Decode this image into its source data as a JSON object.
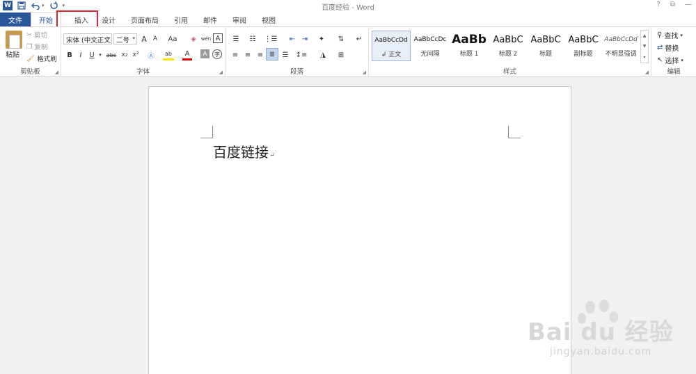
{
  "window": {
    "title": "百度经验 - Word",
    "help": "?",
    "restore": "⧉",
    "minimize": "—"
  },
  "quick_access": {
    "app_icon_letter": "W",
    "save_icon": "save-icon",
    "undo_icon": "undo-icon",
    "redo_icon": "redo-icon"
  },
  "tabs": [
    {
      "label": "文件"
    },
    {
      "label": "开始"
    },
    {
      "label": "插入"
    },
    {
      "label": "设计"
    },
    {
      "label": "页面布局"
    },
    {
      "label": "引用"
    },
    {
      "label": "邮件"
    },
    {
      "label": "审阅"
    },
    {
      "label": "视图"
    }
  ],
  "ribbon": {
    "clipboard": {
      "label": "剪贴板",
      "paste": "粘贴",
      "cut": "剪切",
      "copy": "复制",
      "format_painter": "格式刷"
    },
    "font": {
      "label": "字体",
      "font_name": "宋体 (中文正文",
      "font_size": "二号",
      "grow": "A",
      "shrink": "A",
      "change_case": "Aa",
      "bold": "B",
      "italic": "I",
      "underline": "U",
      "strike": "abc",
      "subscript": "x₂",
      "superscript": "x²",
      "font_color": "A",
      "char_shading": "A",
      "phonetic": "wén",
      "char_border": "A",
      "enclose": "字"
    },
    "paragraph": {
      "label": "段落"
    },
    "styles": {
      "label": "样式",
      "items": [
        {
          "sample": "AaBbCcDd",
          "name": "↲ 正文"
        },
        {
          "sample": "AaBbCcDc",
          "name": "无间隔"
        },
        {
          "sample": "AaBb",
          "name": "标题 1"
        },
        {
          "sample": "AaBbC",
          "name": "标题 2"
        },
        {
          "sample": "AaBbC",
          "name": "标题"
        },
        {
          "sample": "AaBbC",
          "name": "副标题"
        },
        {
          "sample": "AaBbCcDd",
          "name": "不明显强调"
        }
      ]
    },
    "editing": {
      "label": "编辑",
      "find": "查找",
      "replace": "替换",
      "select": "选择"
    }
  },
  "document": {
    "text": "百度链接",
    "paragraph_mark": "↵"
  },
  "watermark": {
    "main": "Bai du 经验",
    "sub": "jingyan.baidu.com"
  },
  "colors": {
    "accent": "#2b579a",
    "highlight_box": "#e0242b"
  }
}
